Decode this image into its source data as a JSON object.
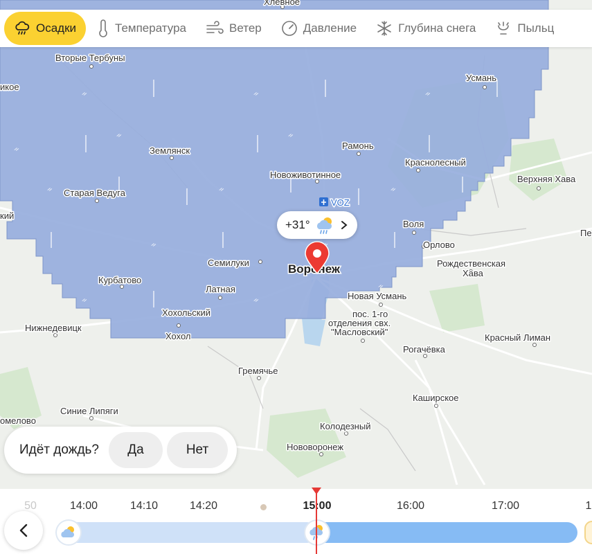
{
  "tabs": [
    {
      "label": "Осадки",
      "icon": "cloud-rain-icon",
      "active": true
    },
    {
      "label": "Температура",
      "icon": "thermometer-icon",
      "active": false
    },
    {
      "label": "Ветер",
      "icon": "wind-icon",
      "active": false
    },
    {
      "label": "Давление",
      "icon": "pressure-gauge-icon",
      "active": false
    },
    {
      "label": "Глубина снега",
      "icon": "snowflake-icon",
      "active": false
    },
    {
      "label": "Пыльц",
      "icon": "pollen-icon",
      "active": false
    }
  ],
  "map": {
    "towns": [
      {
        "name": "Хлевное"
      },
      {
        "name": "Вторые Тербуны"
      },
      {
        "name": "Усмань"
      },
      {
        "name": "икое"
      },
      {
        "name": "Землянск"
      },
      {
        "name": "Рамонь"
      },
      {
        "name": "Краснолесный"
      },
      {
        "name": "Новоживотинное"
      },
      {
        "name": "Верхняя Хава"
      },
      {
        "name": "Старая Ведуга"
      },
      {
        "name": "кий"
      },
      {
        "name": "Воля"
      },
      {
        "name": "Пе"
      },
      {
        "name": "Орлово"
      },
      {
        "name": "Семилуки"
      },
      {
        "name": "Рождественская"
      },
      {
        "name": "Хава"
      },
      {
        "name": "Курбатово"
      },
      {
        "name": "Латная"
      },
      {
        "name": "Новая Усмань"
      },
      {
        "name": "Хохольский"
      },
      {
        "name": "пос. 1-го"
      },
      {
        "name": "отделения свх."
      },
      {
        "name": "\"Масловский\""
      },
      {
        "name": "Нижнедевицк"
      },
      {
        "name": "Хохол"
      },
      {
        "name": "Рогачёвка"
      },
      {
        "name": "Красный Лиман"
      },
      {
        "name": "Гремячье"
      },
      {
        "name": "Каширское"
      },
      {
        "name": "Синие Липяги"
      },
      {
        "name": "омелово"
      },
      {
        "name": "Колодезный"
      },
      {
        "name": "Нововоронеж"
      }
    ],
    "city": "Воронеж",
    "airport": "VOZ",
    "pin": {
      "temp": "+31°",
      "icon": "cloud-sun-rain-icon"
    }
  },
  "colors": {
    "radar": "#97aedd",
    "radar_edge": "#7f96c8",
    "accent": "#fbd131",
    "marker": "#e53935",
    "past_track": "#cfe1f8",
    "future_track": "#86bbf4"
  },
  "rain_question": {
    "text": "Идёт дождь?",
    "yes": "Да",
    "no": "Нет"
  },
  "timeline": {
    "labels": [
      {
        "text": "50"
      },
      {
        "text": "14:00"
      },
      {
        "text": "14:10"
      },
      {
        "text": "14:20"
      },
      {
        "text": "15:00"
      },
      {
        "text": "16:00"
      },
      {
        "text": "17:00"
      },
      {
        "text": "1"
      }
    ],
    "back_icon": "chevron-left-icon"
  }
}
